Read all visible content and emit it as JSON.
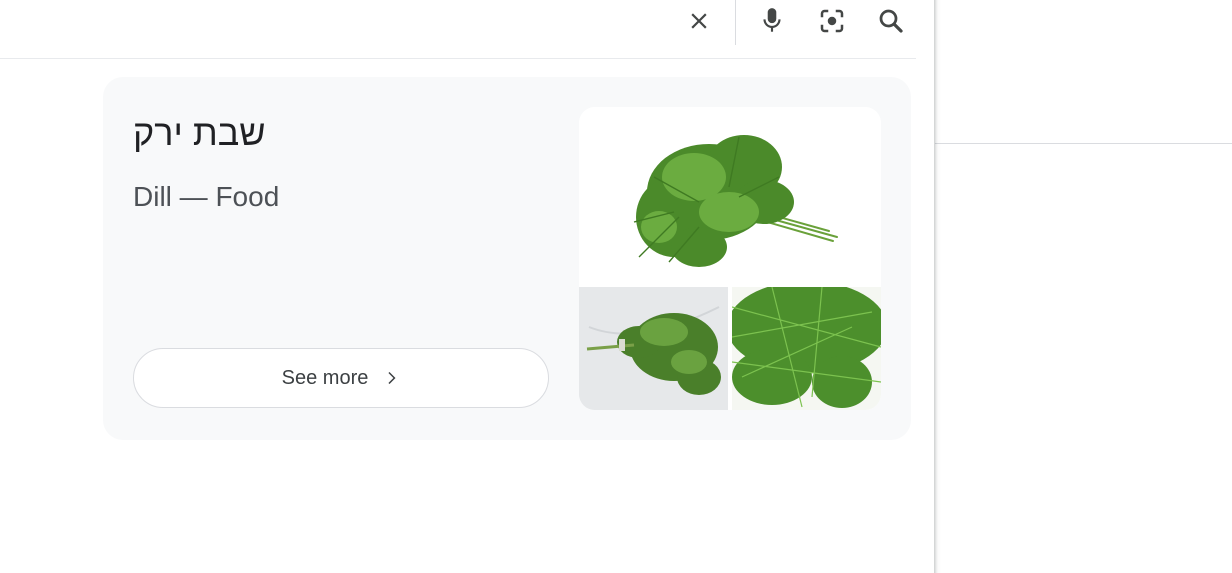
{
  "search_bar": {
    "icons": {
      "clear": "close-icon",
      "voice": "microphone-icon",
      "lens": "camera-lens-icon",
      "search": "search-icon"
    },
    "accent_colors": {
      "icon": "#444746",
      "card_bg": "#f8f9fa",
      "border": "#dadce0"
    }
  },
  "knowledge_card": {
    "title": "שבת ירק",
    "subtitle": "Dill — Food",
    "see_more_label": "See more",
    "see_more_icon": "chevron-right-icon",
    "images": [
      {
        "name": "dill-bunch-image"
      },
      {
        "name": "dill-on-marble-image"
      },
      {
        "name": "dill-fronds-closeup-image"
      }
    ]
  }
}
